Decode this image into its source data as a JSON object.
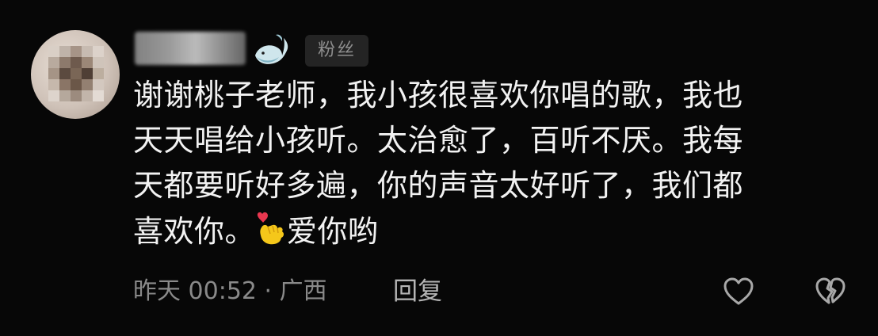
{
  "comment": {
    "badge_label": "粉丝",
    "text_before_emoji": "谢谢桃子老师，我小孩很喜欢你唱的歌，我也\n天天唱给小孩听。太治愈了，百听不厌。我每\n天都要听好多遍，你的声音太好听了，我们都\n喜欢你。",
    "text_after_emoji": "爱你哟",
    "emoji": "finger-heart-icon",
    "time_location": "昨天 00:52 · 广西",
    "reply_label": "回复",
    "icons": {
      "badge": "whale-icon",
      "like": "heart-outline-icon",
      "dislike": "broken-heart-icon"
    },
    "colors": {
      "background": "#070707",
      "text": "#f2f2f2",
      "meta": "#8a8a8a",
      "badge_bg": "#242424",
      "emoji_heart": "#e8374f",
      "emoji_hand": "#f5c71a"
    }
  }
}
